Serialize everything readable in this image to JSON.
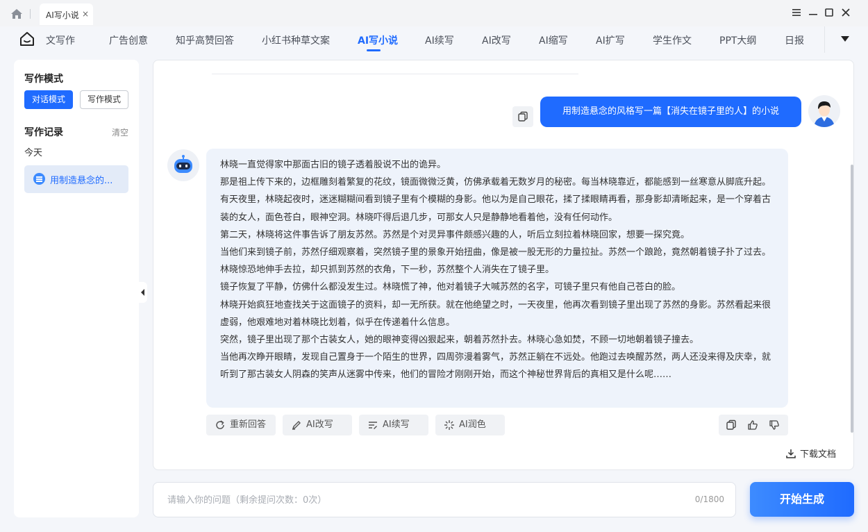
{
  "titlebar": {
    "tab_label": "AI写小说",
    "tab_close": "×"
  },
  "nav": {
    "items": [
      "文写作",
      "广告创意",
      "知乎高赞回答",
      "小红书种草文案",
      "AI写小说",
      "AI续写",
      "AI改写",
      "AI缩写",
      "AI扩写",
      "学生作文",
      "PPT大纲",
      "日报"
    ],
    "active_index": 4
  },
  "sidebar": {
    "mode_title": "写作模式",
    "mode_buttons": [
      "对话模式",
      "写作模式"
    ],
    "history_title": "写作记录",
    "clear_label": "清空",
    "today_label": "今天",
    "history_item": "用制造悬念的..."
  },
  "chat": {
    "user_message": "用制造悬念的风格写一篇【消失在镜子里的人】的小说",
    "response_paragraphs": [
      "林晓一直觉得家中那面古旧的镜子透着股说不出的诡异。",
      "那是祖上传下来的，边框雕刻着繁复的花纹，镜面微微泛黄，仿佛承载着无数岁月的秘密。每当林晓靠近，都能感到一丝寒意从脚底升起。",
      "有天夜里，林晓起夜时，迷迷糊糊间看到镜子里有个模糊的身影。他以为是自己眼花，揉了揉眼睛再看，那身影却清晰起来，是一个穿着古装的女人，面色苍白，眼神空洞。林晓吓得后退几步，可那女人只是静静地看着他，没有任何动作。",
      "第二天，林晓将这件事告诉了朋友苏然。苏然是个对灵异事件颇感兴趣的人，听后立刻拉着林晓回家，想要一探究竟。",
      "当他们来到镜子前，苏然仔细观察着，突然镜子里的景象开始扭曲，像是被一股无形的力量拉扯。苏然一个踉跄，竟然朝着镜子扑了过去。林晓惊恐地伸手去拉，却只抓到苏然的衣角，下一秒，苏然整个人消失在了镜子里。",
      "镜子恢复了平静，仿佛什么都没发生过。林晓慌了神，他对着镜子大喊苏然的名字，可镜子里只有他自己苍白的脸。",
      "林晓开始疯狂地查找关于这面镜子的资料，却一无所获。就在他绝望之时，一天夜里，他再次看到镜子里出现了苏然的身影。苏然看起来很虚弱，他艰难地对着林晓比划着，似乎在传递着什么信息。",
      "突然，镜子里出现了那个古装女人，她的眼神变得凶狠起来，朝着苏然扑去。林晓心急如焚，不顾一切地朝着镜子撞去。",
      "当他再次睁开眼睛，发现自己置身于一个陌生的世界，四周弥漫着雾气，苏然正躺在不远处。他跑过去唤醒苏然，两人还没来得及庆幸，就听到了那古装女人阴森的笑声从迷雾中传来，他们的冒险才刚刚开始，而这个神秘世界背后的真相又是什么呢……"
    ],
    "actions": [
      "重新回答",
      "AI改写",
      "AI续写",
      "AI润色"
    ],
    "download_label": "下载文档"
  },
  "input": {
    "placeholder": "请输入你的问题（剩余提问次数：0次）",
    "counter": "0/1800",
    "submit_label": "开始生成"
  },
  "colors": {
    "accent": "#1f6bff",
    "bubble_bg": "#eef3fb"
  },
  "icons": [
    "home-icon",
    "menu-icon",
    "minimize-icon",
    "maximize-icon",
    "close-icon",
    "app-logo-icon",
    "chevron-down-icon",
    "copy-icon",
    "refresh-icon",
    "pen-icon",
    "continue-icon",
    "sparkle-icon",
    "thumbs-up-icon",
    "thumbs-down-icon",
    "download-icon"
  ]
}
